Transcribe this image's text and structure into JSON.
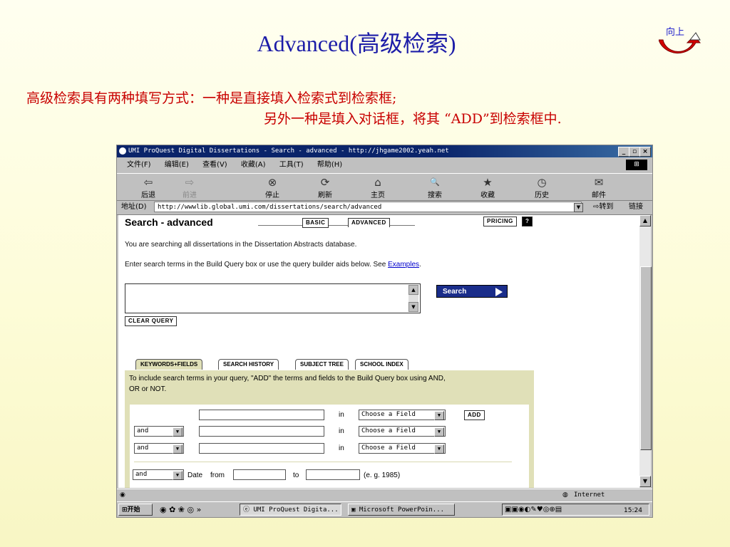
{
  "slide": {
    "title": "Advanced(高级检索)",
    "up_link": "向上",
    "desc_line1": "高级检索具有两种填写方式：一种是直接填入检索式到检索框;",
    "desc_line2": "另外一种是填入对话框，将其 “ADD”到检索框中."
  },
  "window": {
    "title": "UMI ProQuest Digital Dissertations - Search - advanced - http://jhgame2002.yeah.net",
    "controls": [
      "_",
      "▫",
      "×"
    ]
  },
  "menu": [
    "文件(F)",
    "编辑(E)",
    "查看(V)",
    "收藏(A)",
    "工具(T)",
    "帮助(H)"
  ],
  "toolbar": [
    {
      "label": "后退",
      "icon": "back-arrow-icon",
      "glyph": "⇦"
    },
    {
      "label": "前进",
      "icon": "forward-arrow-icon",
      "glyph": "⇨"
    },
    {
      "label": "停止",
      "icon": "stop-icon",
      "glyph": "⊗"
    },
    {
      "label": "刷新",
      "icon": "refresh-icon",
      "glyph": "⟳"
    },
    {
      "label": "主页",
      "icon": "home-icon",
      "glyph": "⌂"
    },
    {
      "label": "搜索",
      "icon": "search-icon",
      "glyph": "🔍"
    },
    {
      "label": "收藏",
      "icon": "favorites-icon",
      "glyph": "★"
    },
    {
      "label": "历史",
      "icon": "history-icon",
      "glyph": "◷"
    },
    {
      "label": "邮件",
      "icon": "mail-icon",
      "glyph": "✉"
    }
  ],
  "address": {
    "label": "地址(D)",
    "url": "http://wwwlib.global.umi.com/dissertations/search/advanced",
    "go": "转到",
    "links": "链接"
  },
  "page": {
    "heading": "Search - advanced",
    "tab_basic": "BASIC",
    "tab_advanced": "ADVANCED",
    "pricing": "PRICING",
    "pricing_help": "?",
    "info1": "You are searching all dissertations in the Dissertation Abstracts database.",
    "info2_prefix": "Enter search terms in the Build Query box or use the query builder aids below. See ",
    "info2_link": "Examples",
    "info2_suffix": ".",
    "search_button": "Search",
    "clear_query": "CLEAR QUERY",
    "tabs": [
      "KEYWORDS+FIELDS",
      "SEARCH HISTORY",
      "SUBJECT TREE",
      "SCHOOL INDEX"
    ],
    "instructions_l1": "To include search terms in your query, \"ADD\" the terms and fields to the Build Query box using AND,",
    "instructions_l2": "OR or NOT.",
    "rows": [
      {
        "operator": "",
        "in": "in",
        "field": "Choose a Field"
      },
      {
        "operator": "and",
        "in": "in",
        "field": "Choose a Field"
      },
      {
        "operator": "and",
        "in": "in",
        "field": "Choose a Field"
      }
    ],
    "add_button": "ADD",
    "date_row": {
      "operator": "and",
      "date": "Date",
      "from": "from",
      "to": "to",
      "example": "(e. g. 1985)"
    }
  },
  "status": {
    "zone": "Internet"
  },
  "taskbar": {
    "start": "开始",
    "tasks": [
      "UMI ProQuest Digita...",
      "Microsoft PowerPoin..."
    ],
    "clock": "15:24"
  }
}
